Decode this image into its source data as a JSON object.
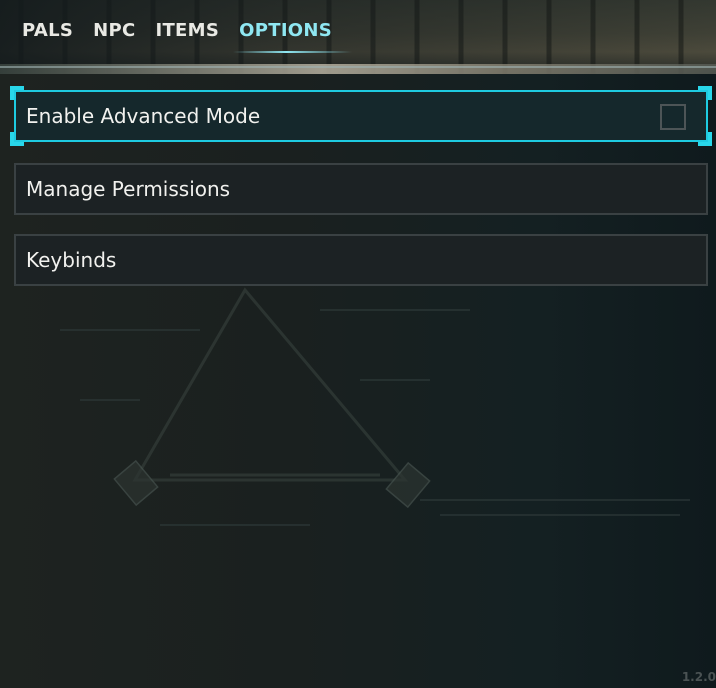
{
  "tabs": [
    {
      "label": "PALS",
      "active": false
    },
    {
      "label": "NPC",
      "active": false
    },
    {
      "label": "ITEMS",
      "active": false
    },
    {
      "label": "OPTIONS",
      "active": true
    }
  ],
  "options": [
    {
      "label": "Enable Advanced Mode",
      "type": "checkbox",
      "checked": false,
      "selected": true
    },
    {
      "label": "Manage Permissions",
      "type": "button",
      "selected": false
    },
    {
      "label": "Keybinds",
      "type": "button",
      "selected": false
    }
  ],
  "version": "1.2.0",
  "colors": {
    "accent": "#1ecbe1",
    "active_tab": "#8fe7f2",
    "row_background": "#1c2224",
    "row_border": "#3a4143"
  }
}
